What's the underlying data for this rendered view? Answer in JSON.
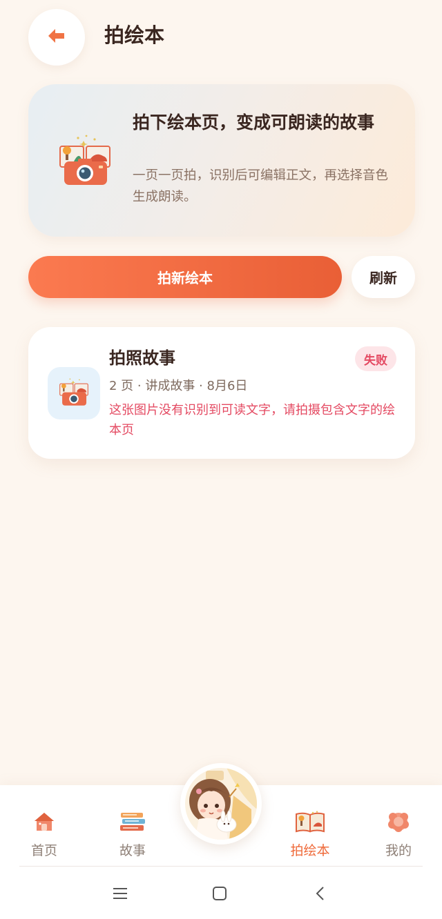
{
  "header": {
    "title": "拍绘本",
    "back_icon": "arrow-left-icon"
  },
  "hero": {
    "title": "拍下绘本页，变成可朗读的故事",
    "description": "一页一页拍，识别后可编辑正文，再选择音色生成朗读。",
    "illustration": "camera-book-icon"
  },
  "actions": {
    "primary_label": "拍新绘本",
    "refresh_label": "刷新"
  },
  "stories": [
    {
      "title": "拍照故事",
      "status": "失败",
      "meta": "2 页 · 讲成故事 · 8月6日",
      "error": "这张图片没有识别到可读文字，请拍摄包含文字的绘本页",
      "thumb_icon": "camera-book-icon"
    }
  ],
  "tabbar": {
    "items": [
      {
        "label": "首页",
        "icon": "home-icon"
      },
      {
        "label": "故事",
        "icon": "books-icon"
      },
      {
        "label": "拍绘本",
        "icon": "picture-book-icon",
        "active": true
      },
      {
        "label": "我的",
        "icon": "profile-icon"
      }
    ],
    "center_avatar": "girl-avatar"
  },
  "colors": {
    "background": "#fdf6ef",
    "accent": "#ef6a3a",
    "error": "#e44a62",
    "text_dark": "#3a2620"
  },
  "system_nav": [
    "menu-icon",
    "home-square-icon",
    "back-chevron-icon"
  ]
}
